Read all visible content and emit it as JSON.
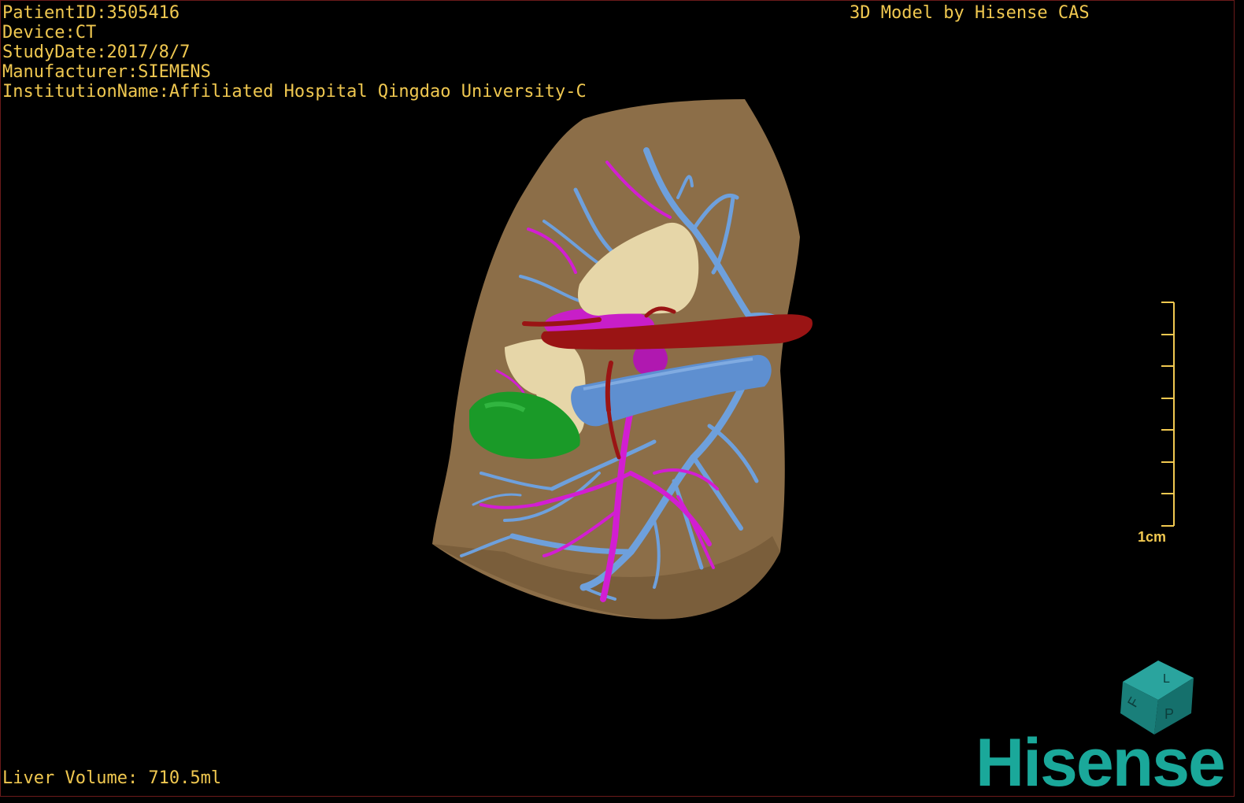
{
  "viewer": {
    "patient_id": "PatientID:3505416",
    "device": "Device:CT",
    "study_date": "StudyDate:2017/8/7",
    "manufacturer": "Manufacturer:SIEMENS",
    "institution": "InstitutionName:Affiliated Hospital Qingdao University-C",
    "brand_caption": "3D Model by Hisense CAS",
    "liver_volume": "Liver Volume: 710.5ml",
    "scale_label": "1cm",
    "logo_text": "Hisense",
    "orientation_cube": {
      "letters": [
        "F",
        "L",
        "P"
      ]
    }
  },
  "colors": {
    "overlay_text": "#f0c850",
    "liver": "#8c6e48",
    "portal_vein": "#6ea0dc",
    "hepatic_vein": "#d21ed2",
    "artery": "#9a1414",
    "gallbladder": "#1a9a28",
    "tumor": "#e6d6a8",
    "logo": "#1aa89a",
    "cube": "#1a8a84"
  }
}
